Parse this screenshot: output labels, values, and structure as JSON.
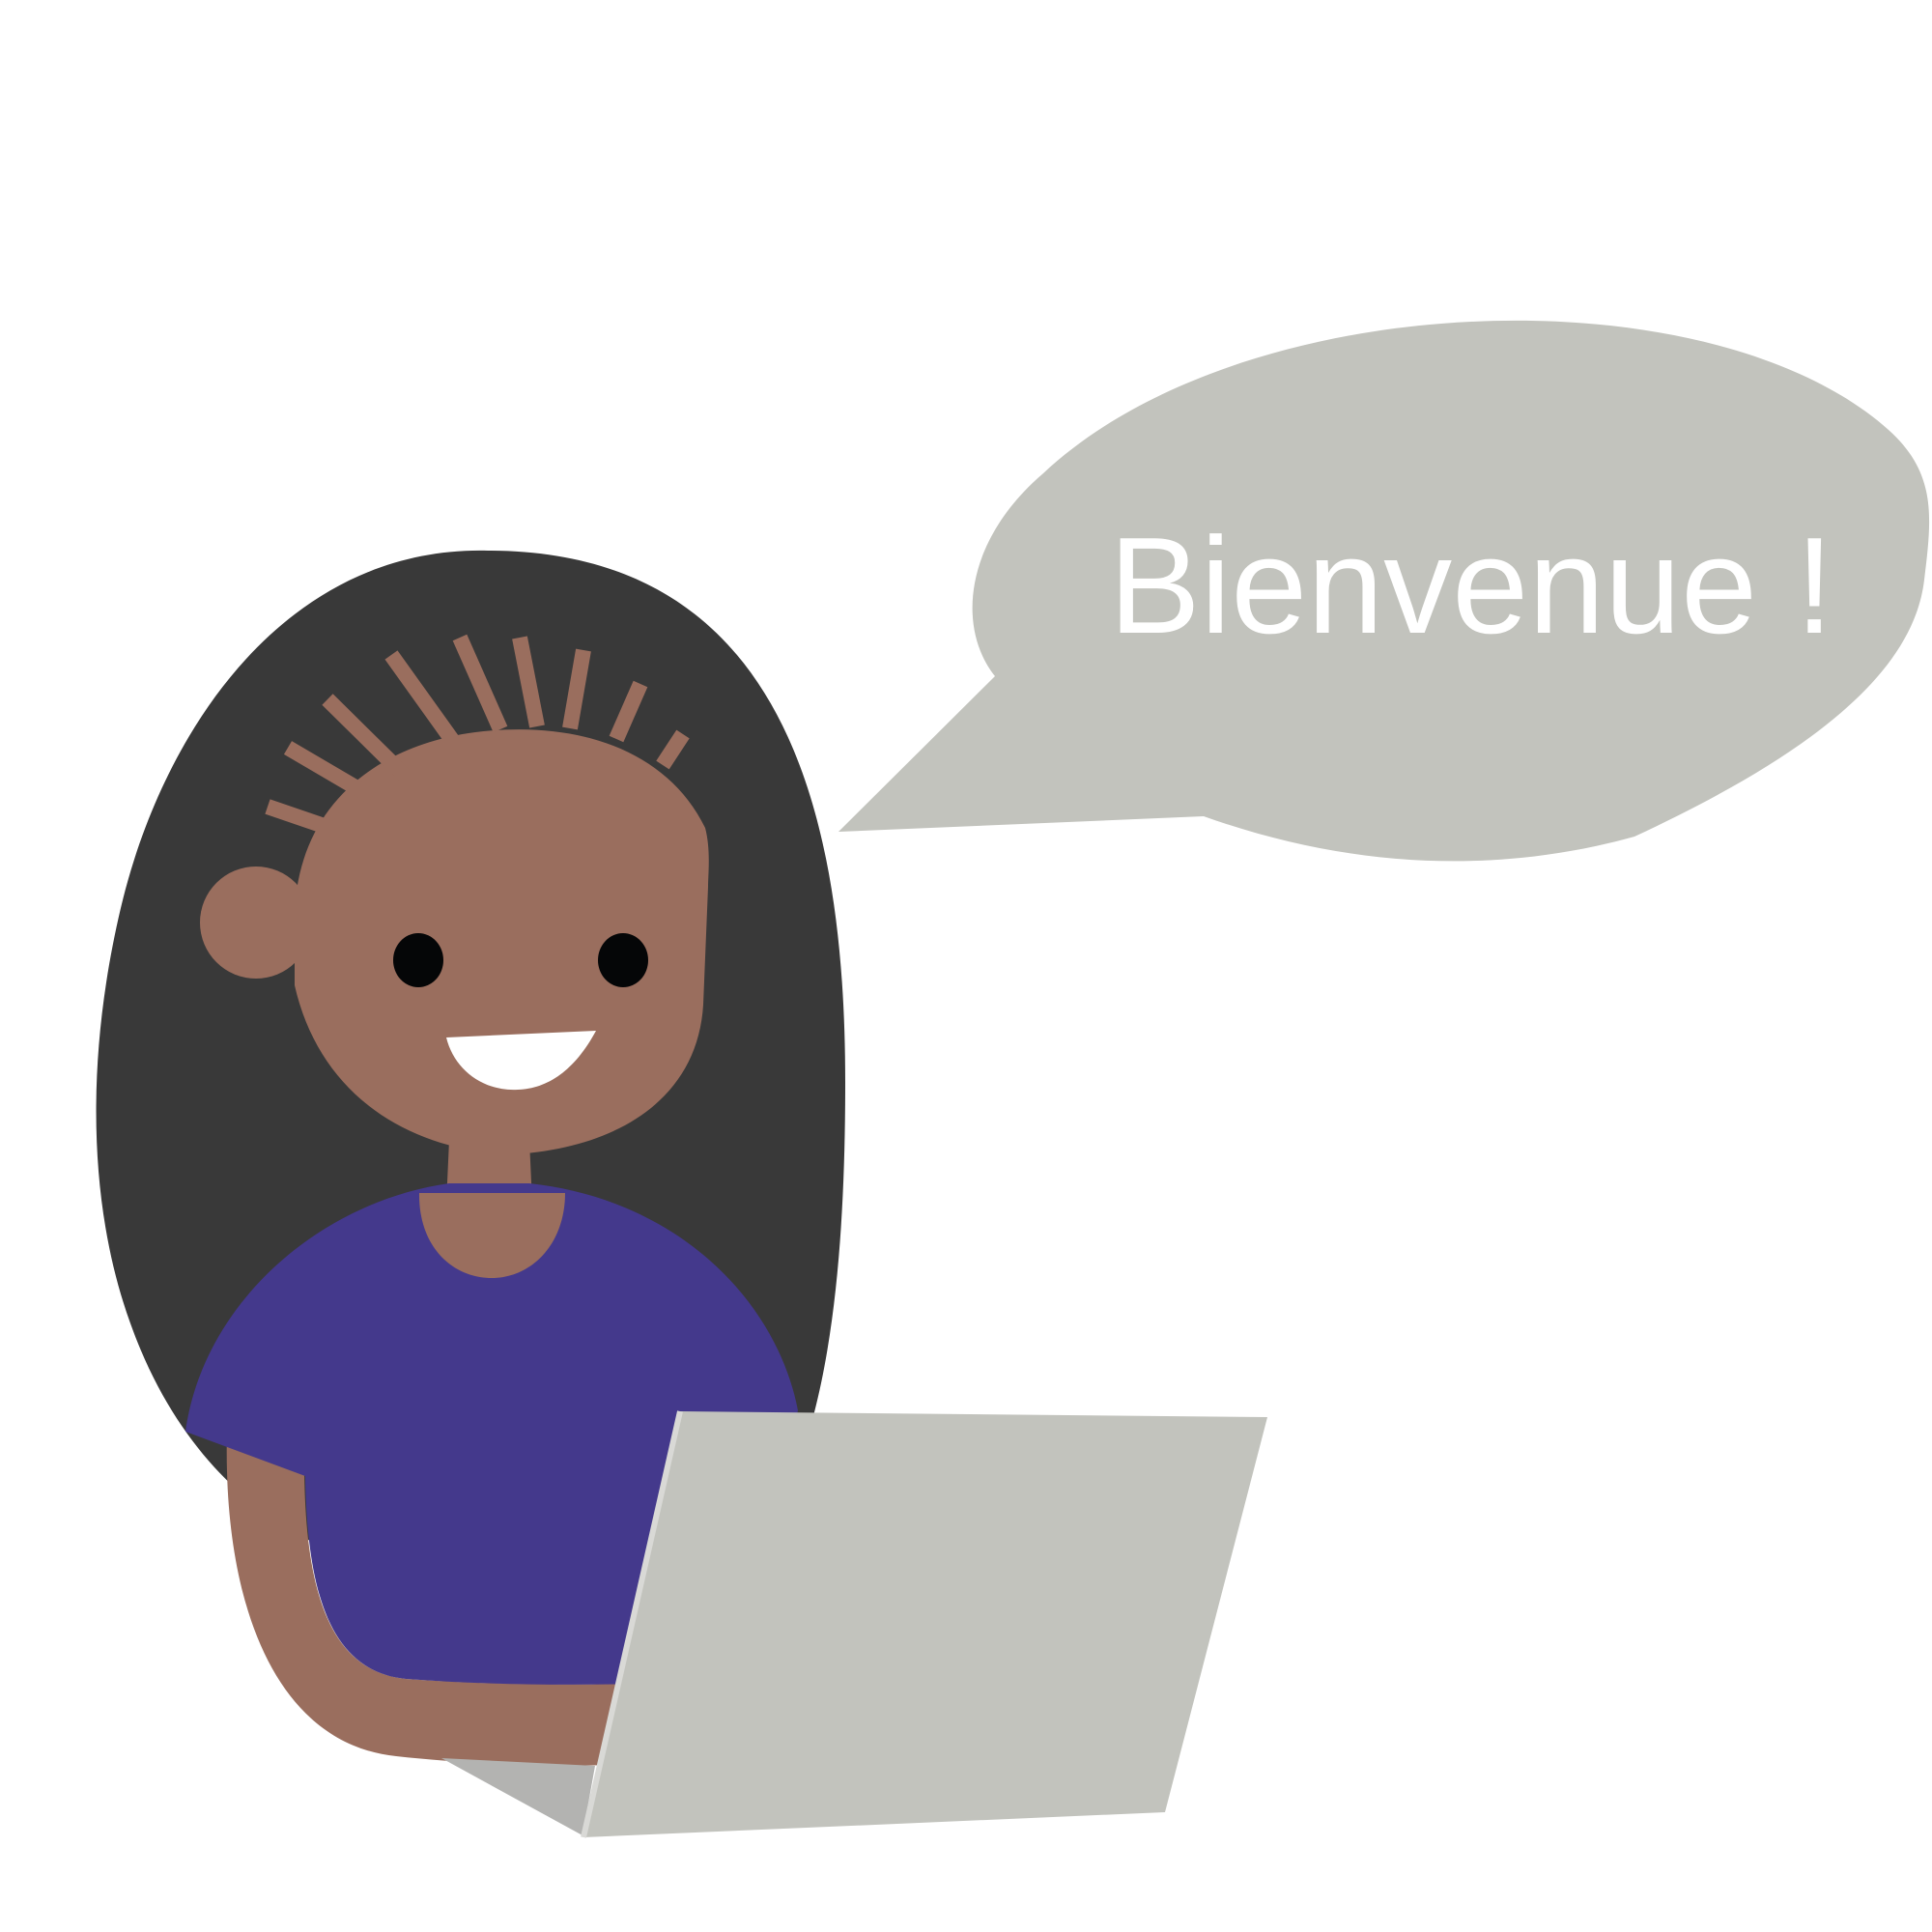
{
  "speech_bubble": {
    "text": "Bienvenue !"
  },
  "colors": {
    "background": "#ffffff",
    "hair": "#393939",
    "skin": "#9a6e5e",
    "shirt": "#44398c",
    "laptop": "#c2c3bd",
    "laptop_edge": "#d9d9d6",
    "laptop_shadow": "#b3b3b1",
    "bubble": "#c2c3bd",
    "eyes": "#050607",
    "teeth": "#ffffff",
    "speech_text": "#ffffff"
  }
}
